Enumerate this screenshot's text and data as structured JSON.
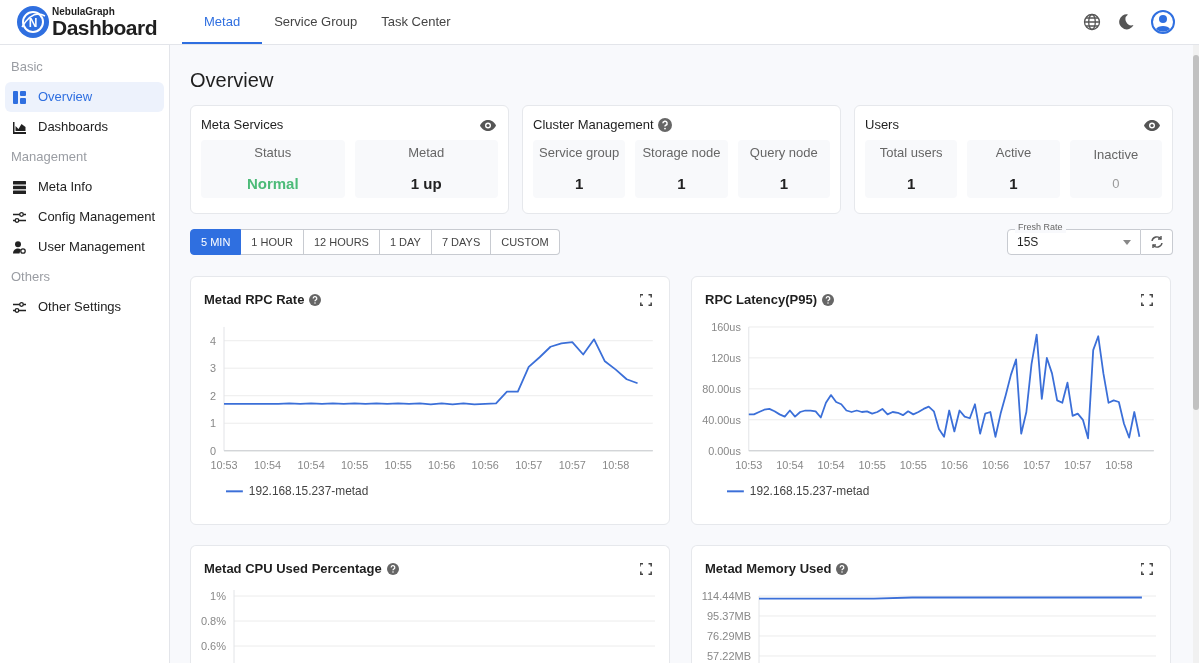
{
  "header": {
    "logo_mark": "N",
    "logo_small": "NebulaGraph",
    "logo_big": "Dashboard",
    "tabs": [
      {
        "label": "Metad",
        "selected": true
      },
      {
        "label": "Service Group",
        "selected": false
      },
      {
        "label": "Task Center",
        "selected": false
      }
    ]
  },
  "sidebar": {
    "sections": [
      {
        "title": "Basic",
        "items": [
          {
            "label": "Overview",
            "kind": "layout",
            "selected": true
          },
          {
            "label": "Dashboards",
            "kind": "area-chart",
            "selected": false
          }
        ]
      },
      {
        "title": "Management",
        "items": [
          {
            "label": "Meta Info",
            "kind": "server",
            "selected": false
          },
          {
            "label": "Config Management",
            "kind": "sliders",
            "selected": false
          },
          {
            "label": "User Management",
            "kind": "user-gear",
            "selected": false
          }
        ]
      },
      {
        "title": "Others",
        "items": [
          {
            "label": "Other Settings",
            "kind": "sliders",
            "selected": false
          }
        ]
      }
    ]
  },
  "page_title": "Overview",
  "summary_cards": [
    {
      "title": "Meta Services",
      "kind": "eye",
      "stats": [
        {
          "label": "Status",
          "value": "Normal",
          "kind": "success"
        },
        {
          "label": "Metad",
          "value": "1 up",
          "kind": "normal"
        }
      ]
    },
    {
      "title": "Cluster Management",
      "kind": "help",
      "stats": [
        {
          "label": "Service group",
          "value": "1",
          "kind": "normal"
        },
        {
          "label": "Storage node",
          "value": "1",
          "kind": "normal"
        },
        {
          "label": "Query node",
          "value": "1",
          "kind": "normal"
        }
      ]
    },
    {
      "title": "Users",
      "kind": "eye",
      "stats": [
        {
          "label": "Total users",
          "value": "1",
          "kind": "normal"
        },
        {
          "label": "Active",
          "value": "1",
          "kind": "normal"
        },
        {
          "label": "Inactive",
          "value": "0",
          "kind": "muted"
        }
      ]
    }
  ],
  "time_ranges": [
    {
      "label": "5 MIN",
      "selected": true
    },
    {
      "label": "1 HOUR",
      "selected": false
    },
    {
      "label": "12 HOURS",
      "selected": false
    },
    {
      "label": "1 DAY",
      "selected": false
    },
    {
      "label": "7 DAYS",
      "selected": false
    },
    {
      "label": "CUSTOM",
      "selected": false
    }
  ],
  "fresh_rate": {
    "label": "Fresh Rate",
    "value": "15S"
  },
  "charts": [
    {
      "title": "Metad RPC Rate",
      "chart_data": {
        "type": "line",
        "ylim": [
          0,
          4.5
        ],
        "categories": [
          "10:53",
          null,
          null,
          null,
          "10:54",
          null,
          null,
          null,
          "10:54",
          null,
          null,
          null,
          "10:55",
          null,
          null,
          null,
          "10:55",
          null,
          null,
          null,
          "10:56",
          null,
          null,
          null,
          "10:56",
          null,
          null,
          null,
          "10:57",
          null,
          null,
          null,
          "10:57",
          null,
          null,
          null,
          "10:58",
          null,
          null
        ],
        "series": [
          {
            "name": "192.168.15.237-metad",
            "color": "#3b6fd8",
            "values": [
              1.7,
              1.7,
              1.7,
              1.7,
              1.7,
              1.7,
              1.72,
              1.7,
              1.72,
              1.7,
              1.72,
              1.7,
              1.72,
              1.7,
              1.72,
              1.7,
              1.72,
              1.7,
              1.72,
              1.68,
              1.72,
              1.68,
              1.72,
              1.68,
              1.7,
              1.72,
              2.15,
              2.15,
              3.05,
              3.4,
              3.78,
              3.9,
              3.95,
              3.5,
              4.05,
              3.25,
              2.95,
              2.6,
              2.45
            ]
          }
        ],
        "yticks": [
          0,
          1,
          2,
          3,
          4
        ],
        "grid": true
      }
    },
    {
      "title": "RPC Latency(P95)",
      "chart_data": {
        "type": "line",
        "ylim": [
          0,
          160
        ],
        "categories": [
          "10:53",
          null,
          null,
          null,
          null,
          null,
          null,
          null,
          "10:54",
          null,
          null,
          null,
          null,
          null,
          null,
          null,
          "10:54",
          null,
          null,
          null,
          null,
          null,
          null,
          null,
          "10:55",
          null,
          null,
          null,
          null,
          null,
          null,
          null,
          "10:55",
          null,
          null,
          null,
          null,
          null,
          null,
          null,
          "10:56",
          null,
          null,
          null,
          null,
          null,
          null,
          null,
          "10:56",
          null,
          null,
          null,
          null,
          null,
          null,
          null,
          "10:57",
          null,
          null,
          null,
          null,
          null,
          null,
          null,
          "10:57",
          null,
          null,
          null,
          null,
          null,
          null,
          null,
          "10:58",
          null,
          null,
          null,
          null
        ],
        "series": [
          {
            "name": "192.168.15.237-metad",
            "color": "#3b6fd8",
            "values": [
              47,
              47,
              50,
              53,
              54,
              51,
              47,
              44,
              52,
              44,
              50,
              52,
              52,
              51,
              43,
              62,
              72,
              63,
              60,
              52,
              50,
              52,
              50,
              51,
              48,
              50,
              54,
              47,
              50,
              49,
              46,
              51,
              47,
              50,
              54,
              57,
              51,
              28,
              18,
              52,
              25,
              52,
              44,
              42,
              60,
              22,
              48,
              50,
              18,
              48,
              72,
              98,
              118,
              22,
              50,
              112,
              150,
              67,
              120,
              100,
              65,
              62,
              88,
              45,
              48,
              40,
              16,
              130,
              148,
              100,
              62,
              65,
              63,
              35,
              17,
              50,
              18
            ]
          }
        ],
        "yticks": [
          {
            "value": 0,
            "label": "0.00us"
          },
          {
            "value": 40,
            "label": "40.00us"
          },
          {
            "value": 80,
            "label": "80.00us"
          },
          {
            "value": 120,
            "label": "120us"
          },
          {
            "value": 160,
            "label": "160us"
          }
        ],
        "grid": true
      }
    },
    {
      "title": "Metad CPU Used Percentage",
      "y_axis_labels": [
        "1%",
        "0.8%",
        "0.6%"
      ]
    },
    {
      "title": "Metad Memory Used",
      "chart_data": {
        "type": "line",
        "ylim": [
          50.5,
          114.44
        ],
        "grid": true,
        "categories": [
          null,
          null,
          null,
          null,
          null,
          null,
          null,
          null,
          null,
          null,
          null
        ],
        "series": [
          {
            "color": "#3b6fd8",
            "values": [
              112,
              112,
              112,
              112,
              113,
              113,
              113,
              113,
              113,
              113,
              113
            ]
          }
        ],
        "yticks": [
          {
            "value": 57.22,
            "label": "57.22MB"
          },
          {
            "value": 76.29,
            "label": "76.29MB"
          },
          {
            "value": 95.37,
            "label": "95.37MB"
          },
          {
            "value": 114.44,
            "label": "114.44MB"
          }
        ]
      }
    }
  ]
}
